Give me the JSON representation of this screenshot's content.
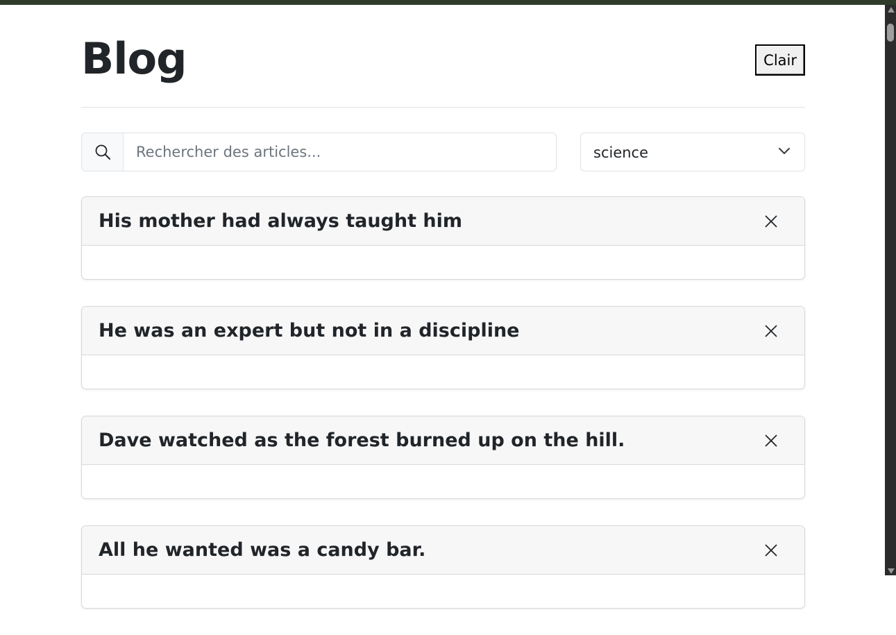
{
  "header": {
    "title": "Blog",
    "theme_button": "Clair"
  },
  "search": {
    "placeholder": "Rechercher des articles...",
    "icon": "search-icon"
  },
  "category_filter": {
    "selected": "science",
    "icon": "chevron-down-icon"
  },
  "articles": [
    {
      "title": "His mother had always taught him",
      "close_icon": "close-icon"
    },
    {
      "title": "He was an expert but not in a discipline",
      "close_icon": "close-icon"
    },
    {
      "title": "Dave watched as the forest burned up on the hill.",
      "close_icon": "close-icon"
    },
    {
      "title": "All he wanted was a candy bar.",
      "close_icon": "close-icon"
    }
  ]
}
